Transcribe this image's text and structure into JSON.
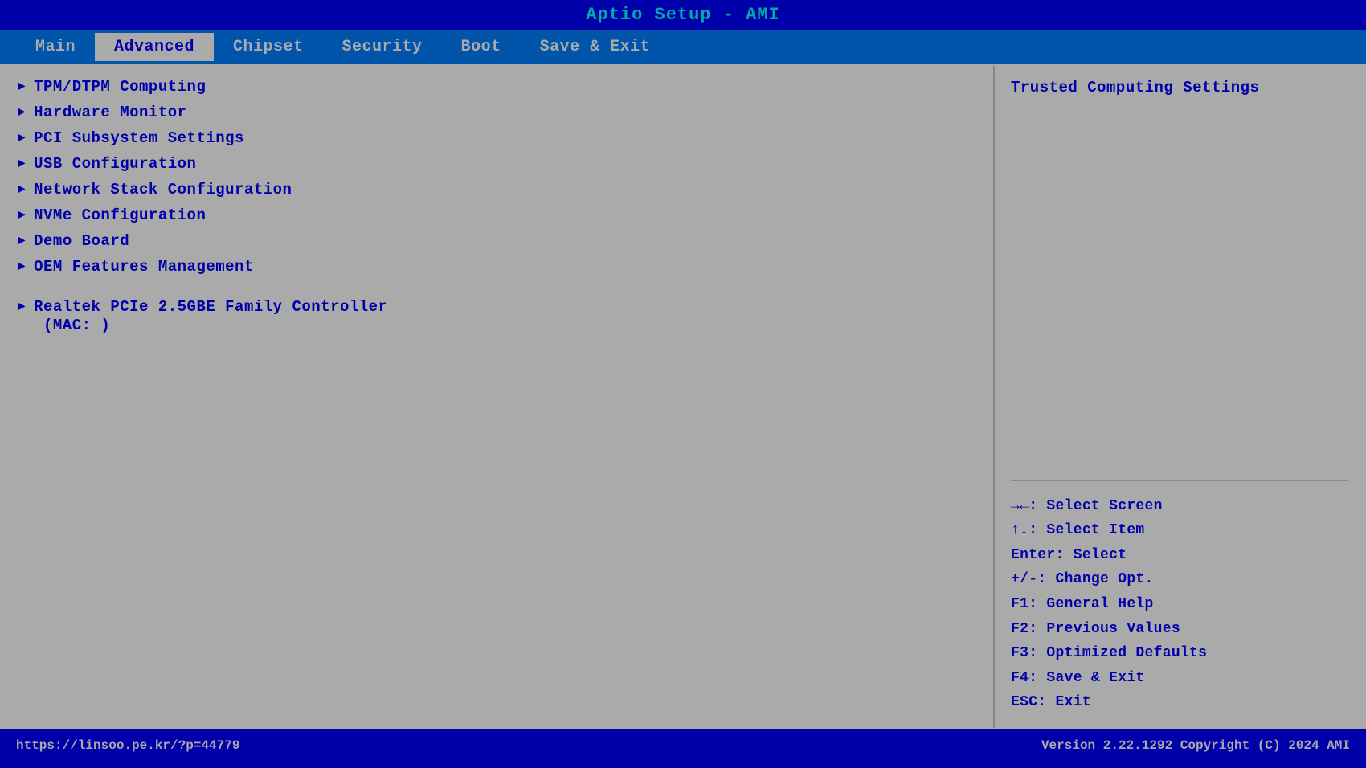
{
  "title": "Aptio Setup - AMI",
  "menu": {
    "items": [
      {
        "label": "Main",
        "active": false
      },
      {
        "label": "Advanced",
        "active": true
      },
      {
        "label": "Chipset",
        "active": false
      },
      {
        "label": "Security",
        "active": false
      },
      {
        "label": "Boot",
        "active": false
      },
      {
        "label": "Save & Exit",
        "active": false
      }
    ]
  },
  "left_panel": {
    "entries": [
      {
        "id": "tpm",
        "arrow": "►",
        "text": "TPM/DTPM Computing",
        "sub": null
      },
      {
        "id": "hw-monitor",
        "arrow": "►",
        "text": "Hardware Monitor",
        "sub": null
      },
      {
        "id": "pci",
        "arrow": "►",
        "text": "PCI Subsystem Settings",
        "sub": null
      },
      {
        "id": "usb",
        "arrow": "►",
        "text": "USB Configuration",
        "sub": null
      },
      {
        "id": "network-stack",
        "arrow": "►",
        "text": "Network Stack Configuration",
        "sub": null
      },
      {
        "id": "nvme",
        "arrow": "►",
        "text": "NVMe Configuration",
        "sub": null
      },
      {
        "id": "demo-board",
        "arrow": "►",
        "text": "Demo Board",
        "sub": null
      },
      {
        "id": "oem",
        "arrow": "►",
        "text": "OEM Features Management",
        "sub": null
      },
      {
        "id": "realtek",
        "arrow": "►",
        "text": "Realtek PCIe 2.5GBE Family Controller",
        "sub": "(MAC:                    )"
      }
    ]
  },
  "right_panel": {
    "help_title": "Trusted Computing Settings",
    "key_hints": [
      "→←: Select Screen",
      "↑↓: Select Item",
      "Enter: Select",
      "+/-: Change Opt.",
      "F1: General Help",
      "F2: Previous Values",
      "F3: Optimized Defaults",
      "F4: Save & Exit",
      "ESC: Exit"
    ]
  },
  "bottom": {
    "url": "https://linsoo.pe.kr/?p=44779",
    "version": "Version 2.22.1292 Copyright (C) 2024 AMI"
  }
}
